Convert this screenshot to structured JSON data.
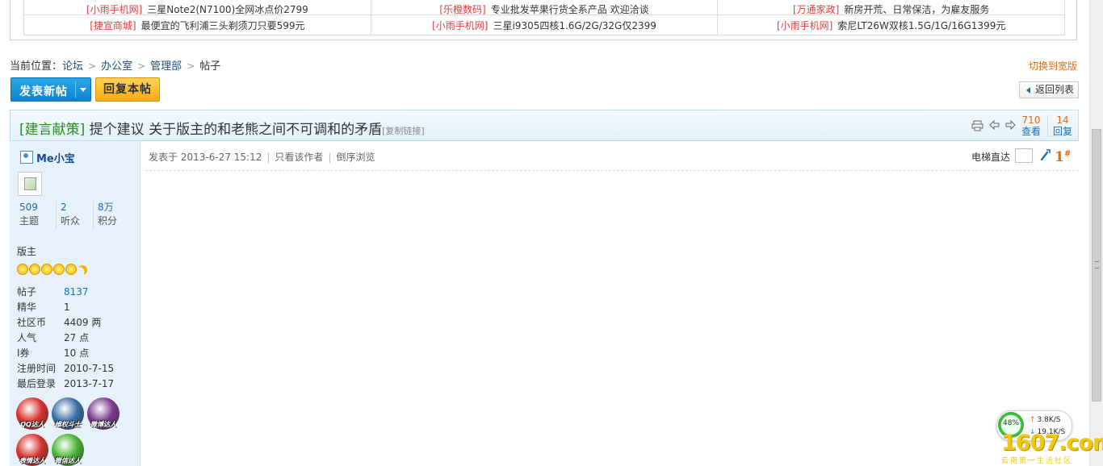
{
  "ads": {
    "row1": [
      {
        "tag": "[小雨手机网]",
        "text": "三星Note2(N7100)全网冰点价2799"
      },
      {
        "tag": "[乐橙数码]",
        "text": "专业批发苹果行货全系产品 欢迎洽谈"
      },
      {
        "tag": "[万通家政]",
        "text": "新房开荒、日常保洁，为雇友服务"
      }
    ],
    "row2": [
      {
        "tag": "[捷宣商城]",
        "text": "最便宜的飞利浦三头剃须刀只要599元"
      },
      {
        "tag": "[小雨手机网]",
        "text": "三星i9305四核1.6G/2G/32G仅2399"
      },
      {
        "tag": "[小雨手机网]",
        "text": "索尼LT26W双核1.5G/1G/16G1399元"
      }
    ]
  },
  "breadcrumb": {
    "prefix": "当前位置：",
    "items": [
      "论坛",
      "办公室",
      "管理部"
    ],
    "current": "帖子",
    "sep": ">"
  },
  "switch_wide": "切换到宽版",
  "buttons": {
    "new_post": "发表新帖",
    "reply": "回复本帖",
    "back_list": "返回列表"
  },
  "thread": {
    "category": "[建言献策]",
    "title": "提个建议 关于版主的和老熊之间不可调和的矛盾",
    "copy_link": "[复制链接]",
    "views": {
      "num": "710",
      "label": "查看"
    },
    "replies": {
      "num": "14",
      "label": "回复"
    }
  },
  "author": {
    "name": "Me小宝",
    "stats": [
      {
        "num": "509",
        "label": "主题"
      },
      {
        "num": "2",
        "label": "听众"
      },
      {
        "num": "8万",
        "label": "积分"
      }
    ],
    "rank": "版主",
    "profile": [
      {
        "k": "帖子",
        "v": "8137"
      },
      {
        "k": "精华",
        "v": "1"
      },
      {
        "k": "社区币",
        "v": "4409 两"
      },
      {
        "k": "人气",
        "v": "27 点"
      },
      {
        "k": "I券",
        "v": "10 点"
      },
      {
        "k": "注册时间",
        "v": "2010-7-15"
      },
      {
        "k": "最后登录",
        "v": "2013-7-17"
      }
    ],
    "medals": [
      {
        "label": "QQ达人",
        "color": "#d8322c"
      },
      {
        "label": "维权斗士",
        "color": "#3b6fa8"
      },
      {
        "label": "微博达人",
        "color": "#7a3a8f"
      },
      {
        "label": "表情达人",
        "color": "#d8322c"
      },
      {
        "label": "微信达人",
        "color": "#48b430"
      }
    ]
  },
  "post": {
    "posted_prefix": "发表于",
    "posted_time": "2013-6-27 15:12",
    "only_author": "只看该作者",
    "reverse": "倒序浏览",
    "floor_jump": "电梯直达",
    "floor": "1",
    "floor_mark": "#"
  },
  "net_widget": {
    "percent": "48%",
    "up": "3.8K/S",
    "down": "19.1K/S"
  },
  "watermark": {
    "main": "1607.com",
    "sub": "云南第一生活社区"
  },
  "colors": {
    "link": "#1b6fb2",
    "accent_orange": "#e06a0f",
    "category_green": "#2b8d20",
    "ad_tag_red": "#e03d3d"
  }
}
